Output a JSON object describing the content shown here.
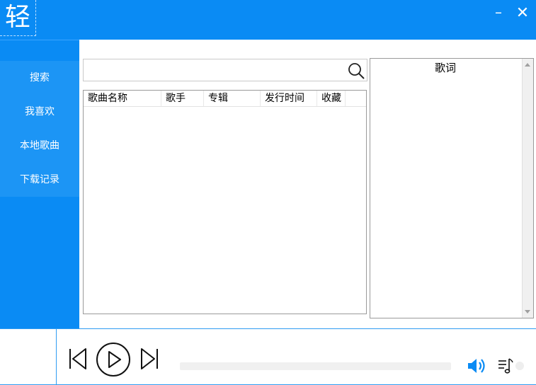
{
  "app": {
    "logo_char": "轻",
    "minimize_label": "–",
    "close_label": "✕"
  },
  "sidebar": {
    "items": [
      {
        "label": "搜索"
      },
      {
        "label": "我喜欢"
      },
      {
        "label": "本地歌曲"
      },
      {
        "label": "下载记录"
      }
    ]
  },
  "search": {
    "placeholder": "",
    "value": "",
    "icon": "search-icon"
  },
  "song_table": {
    "columns": [
      "歌曲名称",
      "歌手",
      "专辑",
      "发行时间",
      "收藏"
    ],
    "rows": []
  },
  "lyrics": {
    "title": "歌词"
  },
  "player": {
    "progress": 0,
    "icons": [
      "previous-icon",
      "play-icon",
      "next-icon",
      "volume-icon",
      "playlist-icon"
    ]
  },
  "colors": {
    "accent": "#0a8bf4",
    "nav_bg": "#1c95f5",
    "border": "#2f9cf2"
  }
}
